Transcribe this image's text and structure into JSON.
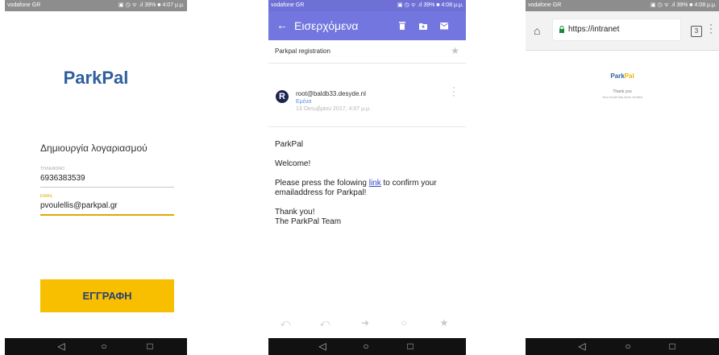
{
  "screen1": {
    "status": {
      "carrier": "vodafone GR",
      "right": "▣ ◷ ᯤ .ıl 39% ■ 4:07 μ.μ."
    },
    "logo": "ParkPal",
    "create_account_label": "Δημιουργία λογαριασμού",
    "phone_field": {
      "label": "ΤΗΛΕΦΩΝΟ",
      "value": "6936383539"
    },
    "email_field": {
      "label": "EMAIL",
      "value": "pvoulellis@parkpal.gr"
    },
    "signup_button": "ΕΓΓΡΑΦΗ"
  },
  "screen2": {
    "status": {
      "carrier": "vodafone GR",
      "right": "▣ ◷ ᯤ .ıl 39% ■ 4:08 μ.μ."
    },
    "appbar_title": "Εισερχόμενα",
    "subject": "Parkpal registration",
    "sender": "root@baldb33.desyde.nl",
    "to": "Εμένα",
    "date": "13 Οκτωβρίου 2017, 4:07 μ.μ.",
    "avatar_letter": "R",
    "body": {
      "greeting_name": "ParkPal",
      "welcome": "Welcome!",
      "line_before_link": "Please press the folowing ",
      "link_text": "link",
      "line_after_link": " to confirm your emailaddress for Parkpal!",
      "thanks": "Thank you!",
      "team": "The ParkPal Team"
    }
  },
  "screen3": {
    "status": {
      "carrier": "vodafone GR",
      "right": "▣ ◷ ᯤ .ıl 39% ■ 4:08 μ.μ."
    },
    "url": "https://intranet",
    "tab_count": "3",
    "logo_park": "Park",
    "logo_pal": "Pal",
    "thank_you": "Thank you",
    "verified_text": "Your email has been verified"
  },
  "colors": {
    "brand_blue": "#2f5f9f",
    "brand_yellow": "#f7bf00",
    "mail_purple": "#7276de",
    "link_blue": "#2b45c8"
  },
  "icons": {
    "navigation": [
      "back-triangle-icon",
      "home-circle-icon",
      "recents-square-icon"
    ],
    "mail_actions": [
      "reply-icon",
      "reply-all-icon",
      "forward-icon",
      "circle-icon",
      "star-icon"
    ],
    "appbar": [
      "back-arrow-icon",
      "delete-icon",
      "move-to-folder-icon",
      "mail-icon"
    ]
  }
}
